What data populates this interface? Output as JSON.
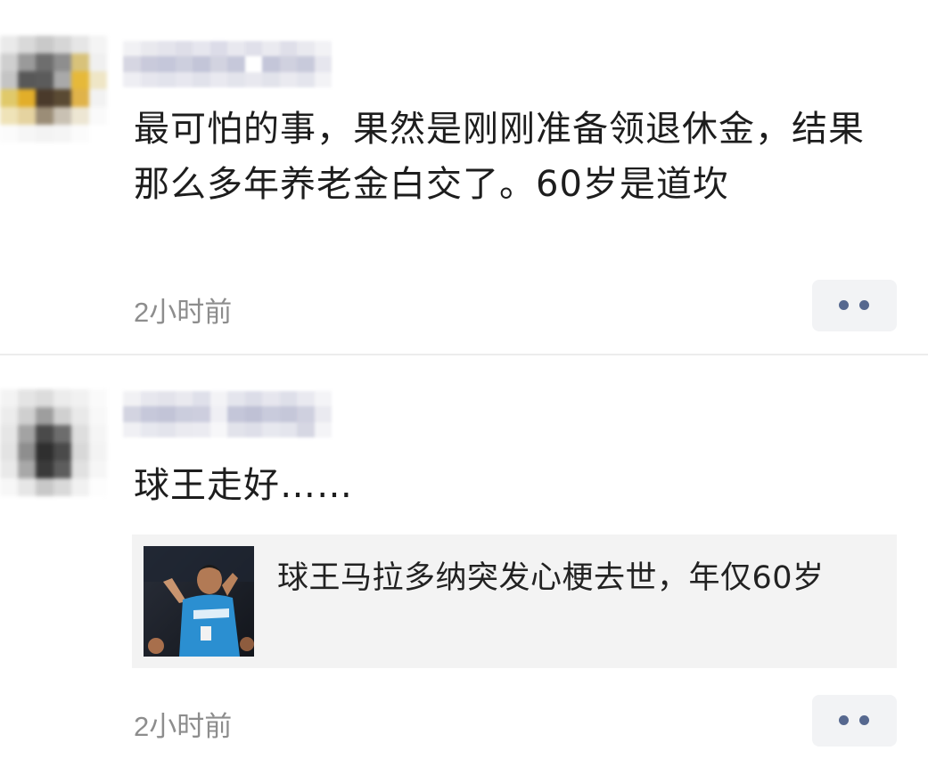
{
  "posts": [
    {
      "comment": "最可怕的事，果然是刚刚准备领退休金，结果那么多年养老金白交了。60岁是道坎",
      "time": "2小时前",
      "more_icon": "more-dots-icon"
    },
    {
      "comment": "球王走好……",
      "link": {
        "title": "球王马拉多纳突发心梗去世，年仅60岁",
        "thumbnail_icon": "news-thumbnail-image"
      },
      "time": "2小时前",
      "more_icon": "more-dots-icon"
    }
  ],
  "colors": {
    "time_gray": "#8d8d8d",
    "dot_blue": "#56688f",
    "button_bg": "#f2f3f5",
    "card_bg": "#f3f3f3"
  }
}
